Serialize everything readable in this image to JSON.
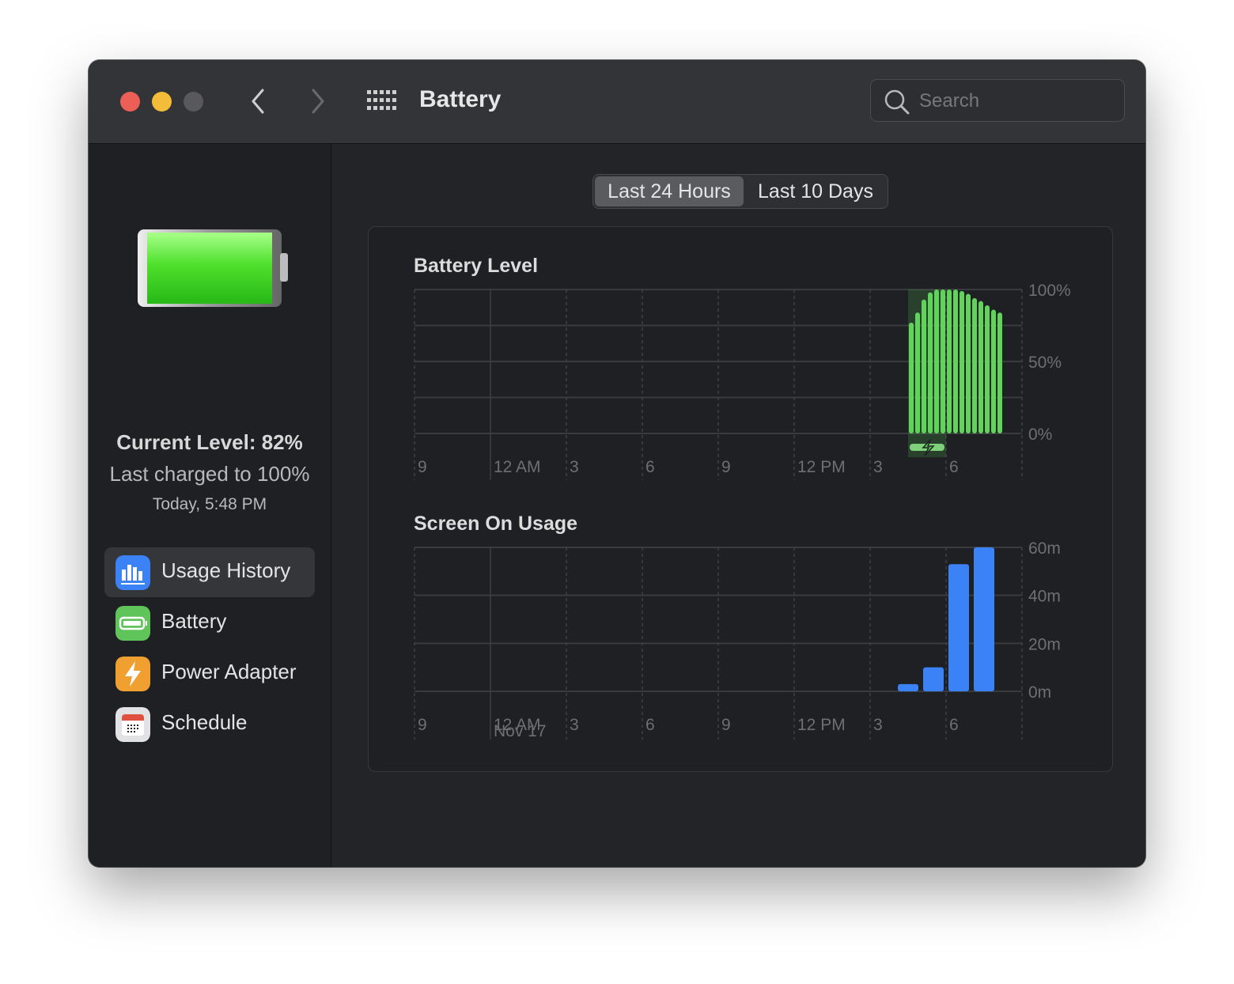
{
  "window": {
    "title": "Battery",
    "search_placeholder": "Search"
  },
  "sidebar": {
    "current_level": "Current Level: 82%",
    "last_charged": "Last charged to 100%",
    "charged_time": "Today, 5:48 PM",
    "items": [
      {
        "label": "Usage History",
        "icon": "bar-chart-icon",
        "color": "#3b82f6",
        "selected": true
      },
      {
        "label": "Battery",
        "icon": "battery-icon",
        "color": "#5fc45a",
        "selected": false
      },
      {
        "label": "Power Adapter",
        "icon": "lightning-icon",
        "color": "#f0a030",
        "selected": false
      },
      {
        "label": "Schedule",
        "icon": "calendar-icon",
        "color": "#e0e0e2",
        "selected": false
      }
    ]
  },
  "segmented": {
    "options": [
      "Last 24 Hours",
      "Last 10 Days"
    ],
    "selected": 0
  },
  "help_label": "?",
  "chart_data": [
    {
      "type": "bar",
      "title": "Battery Level",
      "color": "#5fd35a",
      "x_ticks": [
        "9",
        "12 AM",
        "3",
        "6",
        "9",
        "12 PM",
        "3",
        "6"
      ],
      "y_ticks": [
        "100%",
        "50%",
        "0%"
      ],
      "ylim": [
        0,
        100
      ],
      "x_interval_minutes": 15,
      "x": [
        "4:30 PM",
        "4:45 PM",
        "5:00 PM",
        "5:15 PM",
        "5:30 PM",
        "5:45 PM",
        "6:00 PM",
        "6:15 PM",
        "6:30 PM",
        "6:45 PM",
        "7:00 PM",
        "7:15 PM",
        "7:30 PM",
        "7:45 PM",
        "8:00 PM"
      ],
      "values": [
        77,
        84,
        93,
        98,
        100,
        100,
        100,
        100,
        99,
        97,
        94,
        92,
        89,
        86,
        84
      ],
      "charging": {
        "from": "4:30 PM",
        "to": "5:45 PM"
      }
    },
    {
      "type": "bar",
      "title": "Screen On Usage",
      "color": "#3b82f6",
      "x_ticks": [
        "9",
        "12 AM",
        "3",
        "6",
        "9",
        "12 PM",
        "3",
        "6"
      ],
      "x_sublabel": "Nov 17",
      "y_ticks": [
        "60m",
        "40m",
        "20m",
        "0m"
      ],
      "ylim": [
        0,
        60
      ],
      "x": [
        "4 PM",
        "5 PM",
        "6 PM",
        "7 PM"
      ],
      "values": [
        3,
        10,
        53,
        60
      ]
    }
  ]
}
